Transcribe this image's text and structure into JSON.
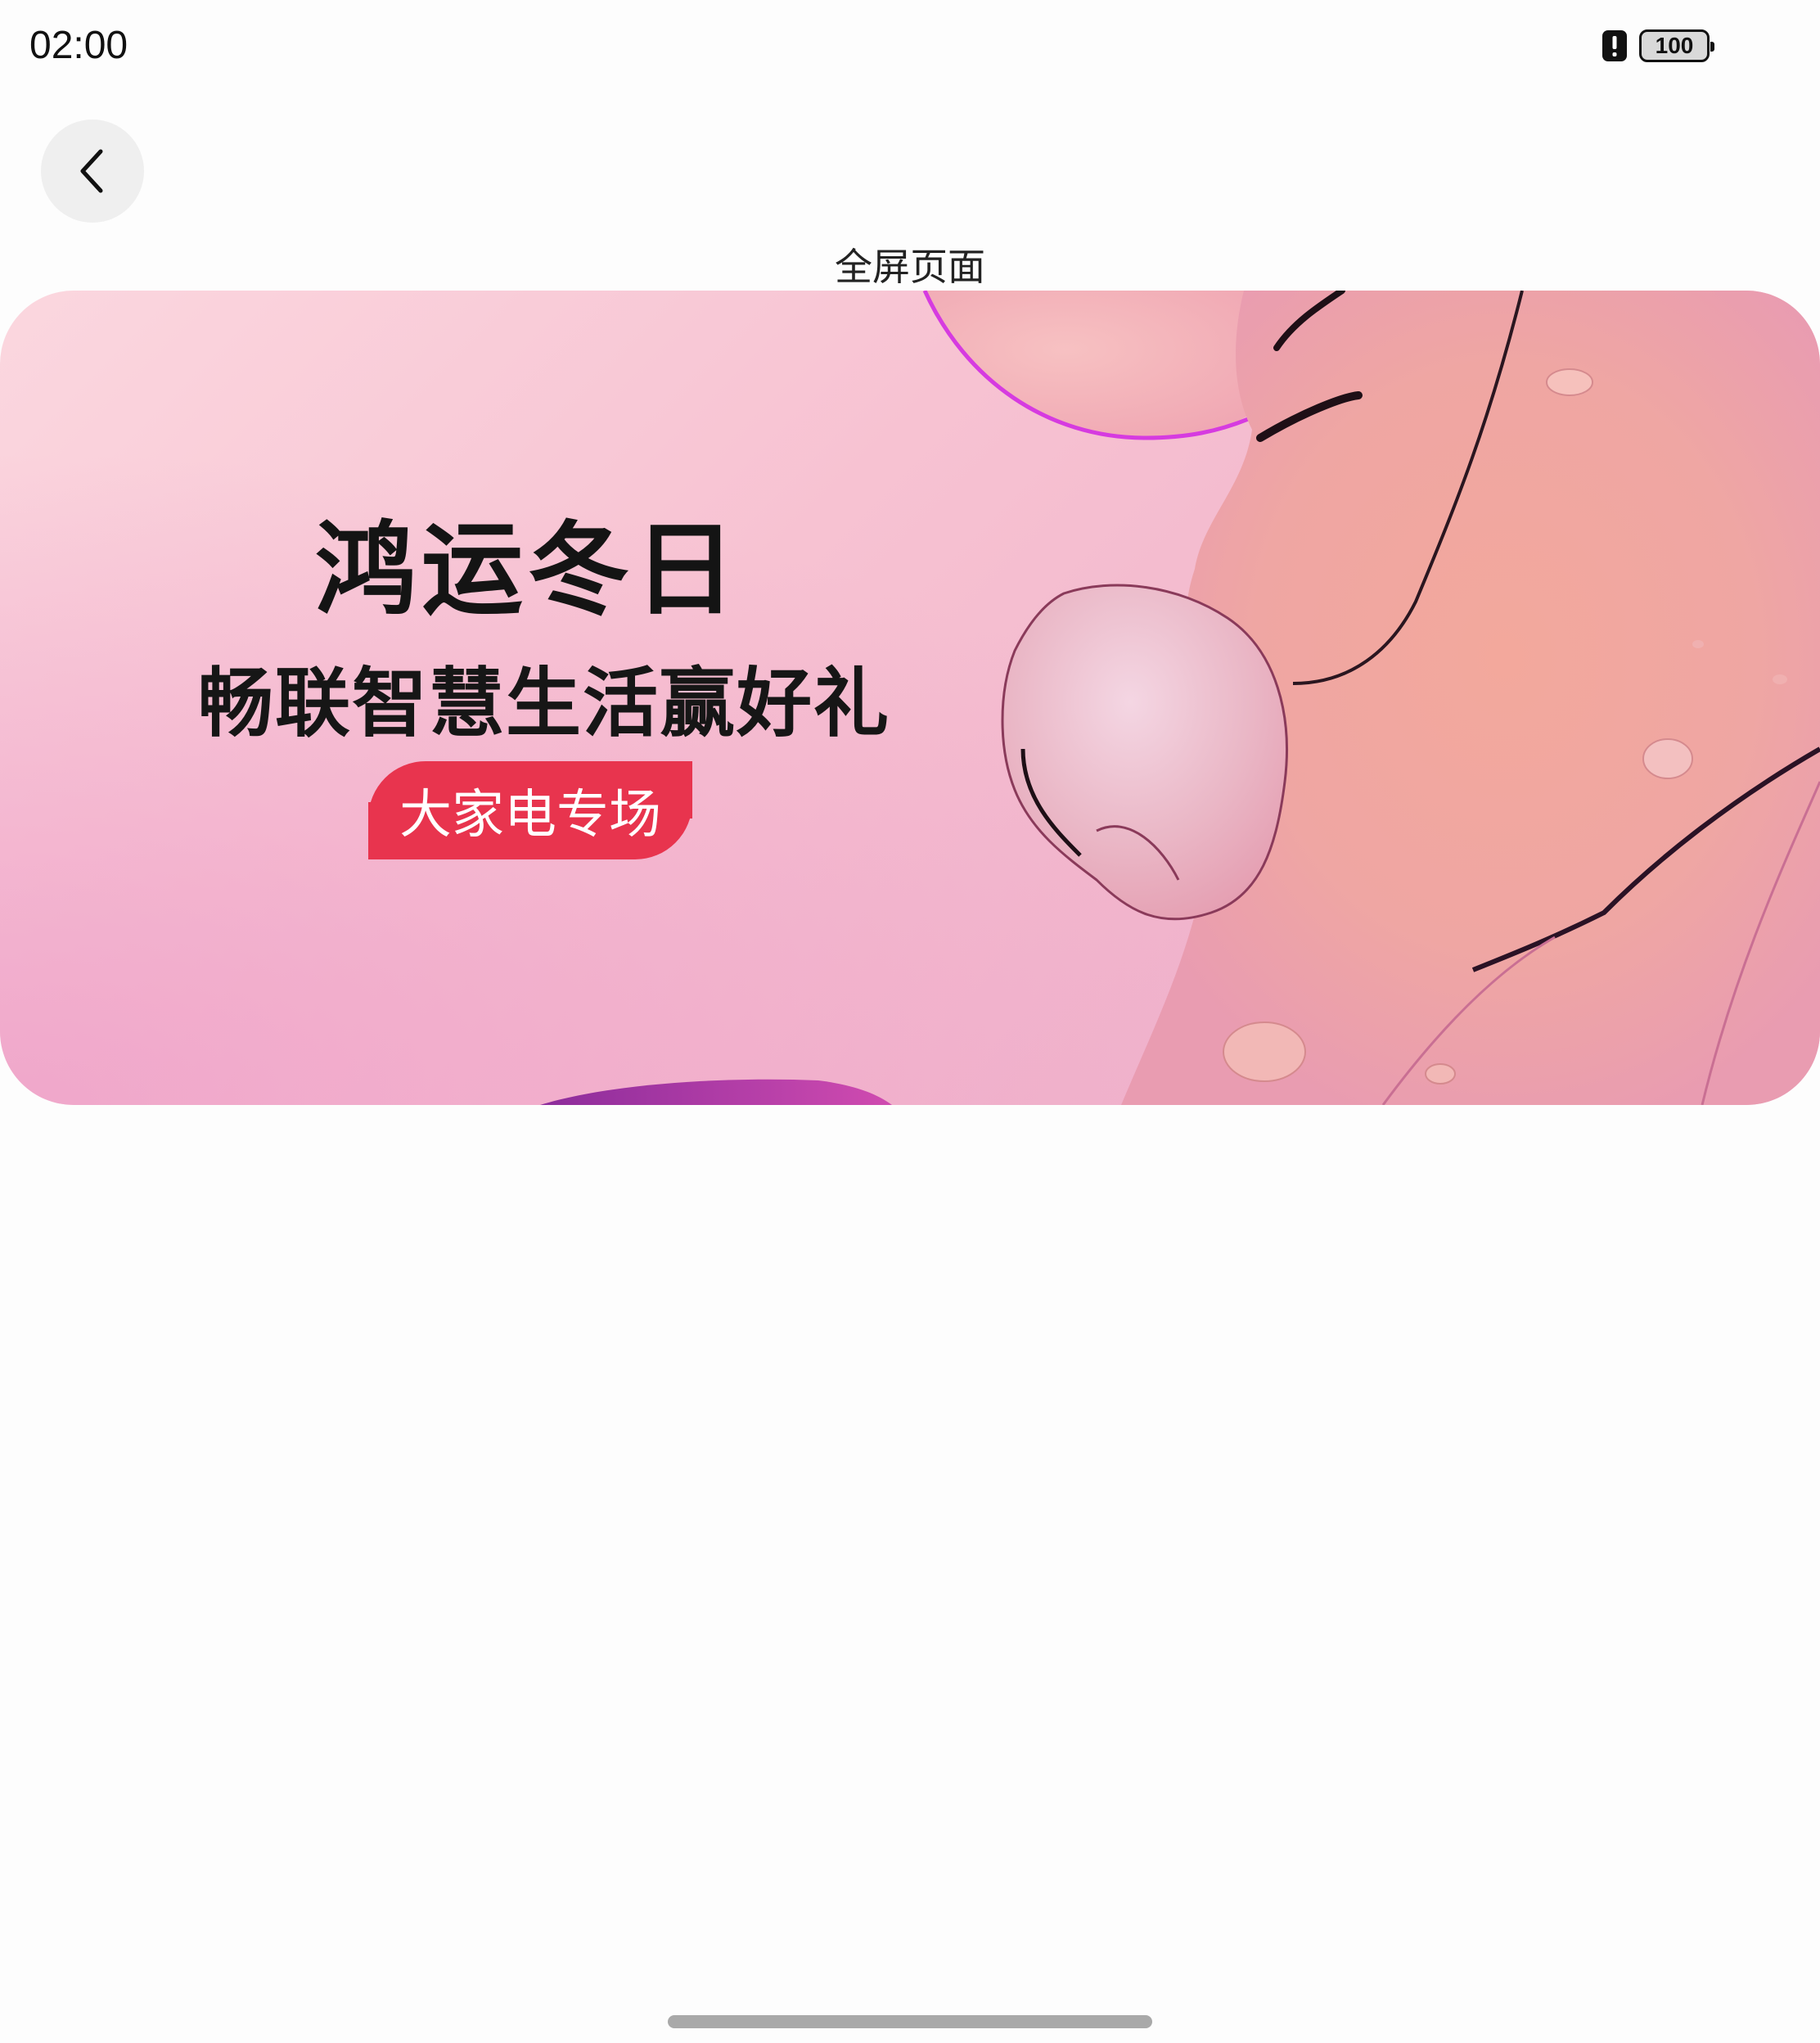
{
  "status_bar": {
    "time": "02:00",
    "battery_level": "100",
    "icons": [
      "alert-icon",
      "battery-icon"
    ]
  },
  "nav": {
    "back_icon": "chevron-left-icon",
    "title": "全屏页面"
  },
  "banner": {
    "headline": "鸿运冬日",
    "subline": "畅联智慧生活赢好礼",
    "tag": "大家电专场",
    "tag_color": "#e8344e"
  }
}
